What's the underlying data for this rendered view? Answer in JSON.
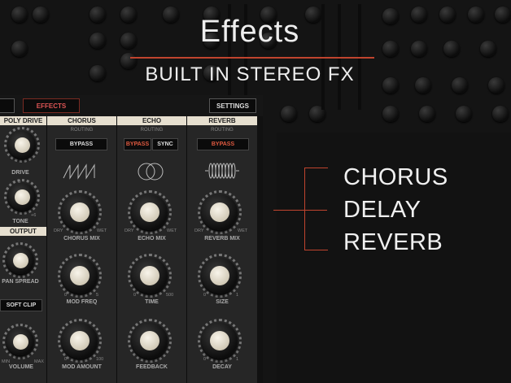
{
  "hero": {
    "title": "Effects",
    "subtitle": "BUILT IN STEREO FX"
  },
  "features": [
    "CHORUS",
    "DELAY",
    "REVERB"
  ],
  "topbar": {
    "effects_label": "EFFECTS",
    "settings_label": "SETTINGS"
  },
  "poly_drive": {
    "title": "POLY DRIVE",
    "drive": "DRIVE",
    "tone": "TONE",
    "tone_min": "0",
    "tone_max": "+6"
  },
  "output": {
    "title": "OUTPUT",
    "pan_spread": "PAN SPREAD",
    "soft_clip": "SOFT CLIP",
    "volume": "VOLUME",
    "vol_min": "MIN",
    "vol_max": "MAX"
  },
  "chorus": {
    "title": "CHORUS",
    "routing": "ROUTING",
    "bypass": "BYPASS",
    "mix": "CHORUS MIX",
    "dry": "DRY",
    "wet": "WET",
    "mod_freq": "MOD FREQ",
    "mf_min": "0",
    "mf_max": "5",
    "mod_amount": "MOD AMOUNT",
    "ma_min": "0",
    "ma_max": "100"
  },
  "echo": {
    "title": "ECHO",
    "routing": "ROUTING",
    "bypass": "BYPASS",
    "sync": "SYNC",
    "mix": "ECHO MIX",
    "dry": "DRY",
    "wet": "WET",
    "time": "TIME",
    "t_min": "0",
    "t_max": "500",
    "feedback": "FEEDBACK"
  },
  "reverb": {
    "title": "REVERB",
    "routing": "ROUTING",
    "bypass": "BYPASS",
    "mix": "REVERB MIX",
    "dry": "DRY",
    "wet": "WET",
    "size": "SIZE",
    "s_min": "0",
    "s_max": "1",
    "decay": "DECAY",
    "d_min": "0",
    "d_max": "1"
  },
  "colors": {
    "accent": "#c0442e",
    "panel_header": "#e6dfcf"
  }
}
